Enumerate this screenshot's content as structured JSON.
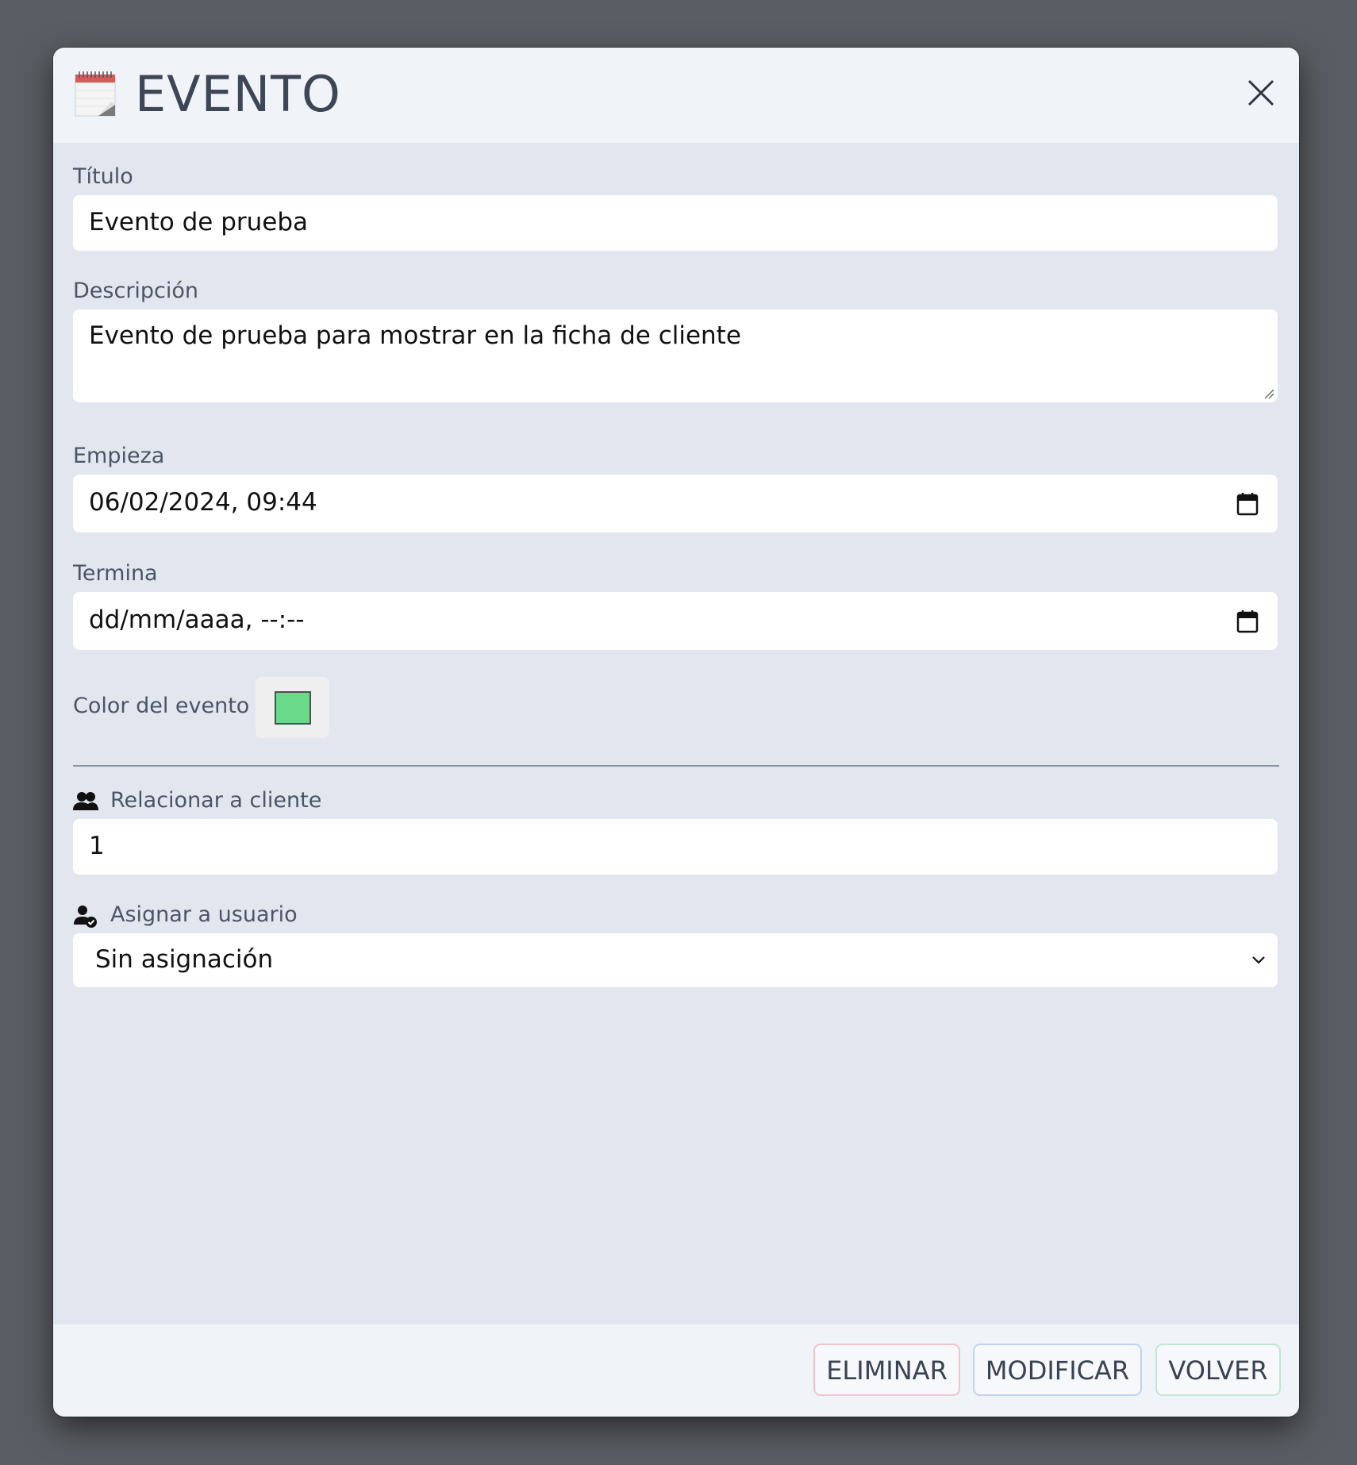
{
  "modal": {
    "title": "EVENTO",
    "title_icon": "calendar-icon",
    "close_icon": "close-icon"
  },
  "form": {
    "titulo": {
      "label": "Título",
      "value": "Evento de prueba"
    },
    "descripcion": {
      "label": "Descripción",
      "value": "Evento de prueba para mostrar en la ficha de cliente"
    },
    "empieza": {
      "label": "Empieza",
      "value": "06/02/2024, 09:44"
    },
    "termina": {
      "label": "Termina",
      "placeholder": "dd/mm/aaaa, --:--"
    },
    "color": {
      "label": "Color del evento",
      "value": "#6bd98a"
    },
    "cliente": {
      "label": "Relacionar a cliente",
      "value": "1",
      "icon": "users-icon"
    },
    "usuario": {
      "label": "Asignar a usuario",
      "selected": "Sin asignación",
      "icon": "user-check-icon"
    }
  },
  "footer": {
    "eliminar": "ELIMINAR",
    "modificar": "MODIFICAR",
    "volver": "VOLVER"
  },
  "colors": {
    "modal_bg": "#e2e6ee",
    "header_bg": "#f0f3f8",
    "danger_border": "#f1c4c8",
    "primary_border": "#bcd4f2",
    "success_border": "#bfe8cf"
  }
}
